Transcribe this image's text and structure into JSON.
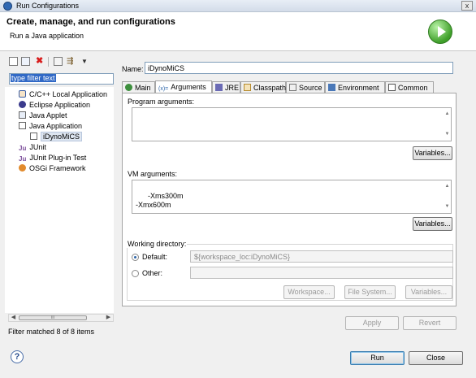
{
  "window": {
    "title": "Run Configurations",
    "close_glyph": "x"
  },
  "header": {
    "title": "Create, manage, and run configurations",
    "subtitle": "Run a Java application"
  },
  "left": {
    "toolbar_icons": [
      "new-launch-configuration-icon",
      "duplicate-icon",
      "delete-icon",
      "collapse-all-icon",
      "filter-icon",
      "view-menu-icon"
    ],
    "filter": {
      "value": "type filter text"
    },
    "tree": [
      {
        "label": "C/C++ Local Application",
        "icon": "cpp-app-icon"
      },
      {
        "label": "Eclipse Application",
        "icon": "eclipse-icon"
      },
      {
        "label": "Java Applet",
        "icon": "java-applet-icon"
      },
      {
        "label": "Java Application",
        "icon": "java-app-icon"
      },
      {
        "label": "iDynoMiCS",
        "icon": "java-app-icon",
        "selected": true
      },
      {
        "label": "JUnit",
        "icon": "junit-icon"
      },
      {
        "label": "JUnit Plug-in Test",
        "icon": "junit-icon"
      },
      {
        "label": "OSGi Framework",
        "icon": "osgi-icon"
      }
    ],
    "scroll_thumb_glyph": "III",
    "status": "Filter matched 8 of 8 items"
  },
  "right": {
    "name_label": "Name:",
    "name_value": "iDynoMiCS",
    "tabs": [
      {
        "label": "Main",
        "icon": "main-tab-icon"
      },
      {
        "label": "Arguments",
        "icon": "arguments-tab-icon",
        "active": true
      },
      {
        "label": "JRE",
        "icon": "jre-tab-icon"
      },
      {
        "label": "Classpath",
        "icon": "classpath-tab-icon"
      },
      {
        "label": "Source",
        "icon": "source-tab-icon"
      },
      {
        "label": "Environment",
        "icon": "environment-tab-icon"
      },
      {
        "label": "Common",
        "icon": "common-tab-icon"
      }
    ],
    "program_args": {
      "label": "Program arguments:",
      "value": "",
      "variables_button": "Variables..."
    },
    "vm_args": {
      "label": "VM arguments:",
      "value": "-Xms300m\n-Xmx600m",
      "variables_button": "Variables..."
    },
    "working_dir": {
      "label": "Working directory:",
      "default_label": "Default:",
      "default_value": "${workspace_loc:iDynoMiCS}",
      "other_label": "Other:",
      "other_value": "",
      "workspace_button": "Workspace...",
      "filesystem_button": "File System...",
      "variables_button": "Variables..."
    },
    "apply_button": "Apply",
    "revert_button": "Revert"
  },
  "footer": {
    "help_glyph": "?",
    "run_button": "Run",
    "close_button": "Close"
  },
  "colors": {
    "accent": "#3169c6",
    "run_green": "#3f9f2a"
  }
}
